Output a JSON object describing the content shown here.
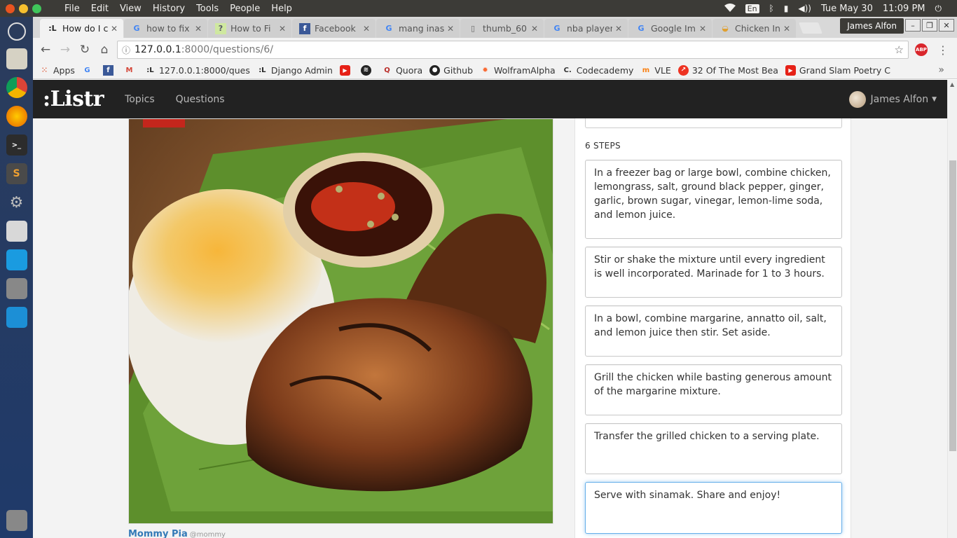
{
  "os": {
    "menu": [
      "File",
      "Edit",
      "View",
      "History",
      "Tools",
      "People",
      "Help"
    ],
    "tray_lang": "En",
    "date": "Tue May 30",
    "time": "11:09 PM"
  },
  "browser": {
    "tabs": [
      {
        "title": "How do I c",
        "active": true
      },
      {
        "title": "how to fix",
        "active": false
      },
      {
        "title": "How to Fi",
        "active": false
      },
      {
        "title": "Facebook",
        "active": false
      },
      {
        "title": "mang inas",
        "active": false
      },
      {
        "title": "thumb_60",
        "active": false
      },
      {
        "title": "nba player",
        "active": false
      },
      {
        "title": "Google Im",
        "active": false
      },
      {
        "title": "Chicken In",
        "active": false
      }
    ],
    "profile_name": "James Alfon",
    "url_host": "127.0.0.1",
    "url_rest": ":8000/questions/6/",
    "bookmarks": [
      "Apps",
      "127.0.0.1:8000/ques",
      "Django Admin",
      "Quora",
      "Github",
      "WolframAlpha",
      "Codecademy",
      "VLE",
      "32 Of The Most Bea",
      "Grand Slam Poetry C"
    ]
  },
  "site": {
    "brand": ":Listr",
    "nav": [
      "Topics",
      "Questions"
    ],
    "user_name": "James Alfon",
    "author_name": "Mommy Pia",
    "author_handle": "@mommy",
    "steps_label": "6 STEPS",
    "steps": [
      "In a freezer bag or large bowl, combine chicken, lemongrass, salt, ground black pepper, ginger, garlic, brown sugar, vinegar, lemon-lime soda, and lemon juice.",
      "Stir or shake the mixture until every ingredient is well incorporated. Marinade for 1 to 3 hours.",
      "In a bowl, combine margarine, annatto oil, salt, and lemon juice then stir. Set aside.",
      "Grill the chicken while basting generous amount of the margarine mixture.",
      "Transfer the grilled chicken to a serving plate.",
      "Serve with sinamak. Share and enjoy!"
    ]
  }
}
